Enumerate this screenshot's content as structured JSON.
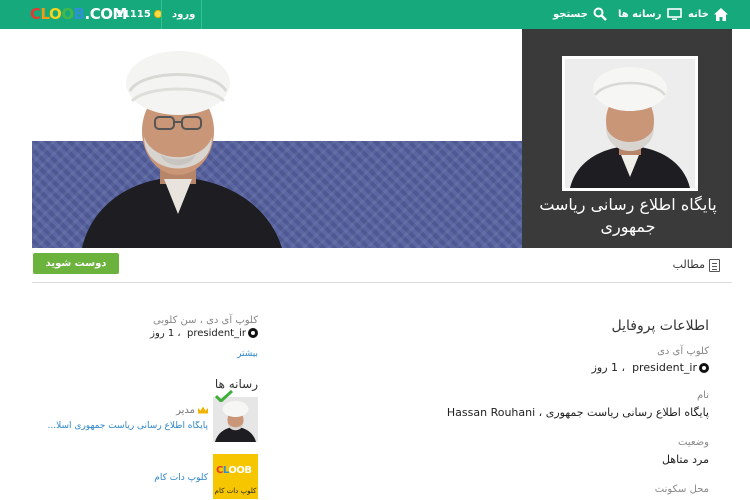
{
  "topbar": {
    "logo_text": "CLOOB.COM",
    "coins": "11115",
    "login_label": "ورود",
    "search_label": "جستجو",
    "media_label": "رسانه ها",
    "home_label": "خانه"
  },
  "page": {
    "title": "پایگاه اطلاع رسانی ریاست جمهوری"
  },
  "actions": {
    "friend_button": "دوست شوید",
    "posts_tab": "مطالب"
  },
  "profile": {
    "heading": "اطلاعات پروفایل",
    "club_id_label": "کلوپ آی دی",
    "club_id_value": "president_ir",
    "age_value": "، 1 روز",
    "name_label": "نام",
    "name_value": "پایگاه اطلاع رسانی ریاست جمهوری ، Hassan Rouhani",
    "status_label": "وضعیت",
    "status_value": "مرد متاهل",
    "location_label": "محل سکونت"
  },
  "sidebar": {
    "club_info_label": "کلوپ آی دی ، سن کلوبی",
    "club_id_value": "president_ir",
    "age_value": "، 1 روز",
    "more_link": "بیشتر",
    "media_heading": "رسانه ها",
    "media_items": [
      {
        "role": "مدیر",
        "title": "پایگاه اطلاع رسانی ریاست جمهوری اسلا..."
      },
      {
        "title": "کلوپ دات کام",
        "thumb_caption": "کلوپ دات کام"
      }
    ]
  },
  "colors": {
    "topbar": "#16a97c",
    "friend_button": "#6cb33e",
    "link": "#2e86c9",
    "panel": "#3a3a3a"
  }
}
